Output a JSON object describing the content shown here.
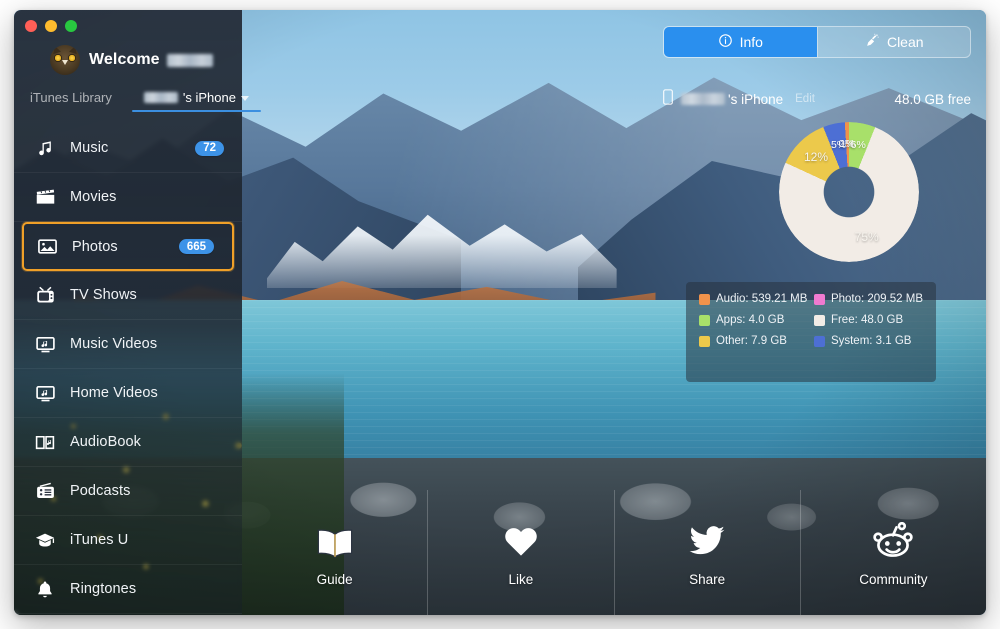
{
  "window": {
    "traffic_lights": [
      "close",
      "minimize",
      "zoom"
    ],
    "accent_blue": "#2a8fee",
    "highlight_orange": "#f0a028"
  },
  "sidebar": {
    "welcome_label": "Welcome",
    "welcome_name_redacted": true,
    "tabs": [
      {
        "label": "iTunes Library",
        "active": false
      },
      {
        "label": "'s iPhone",
        "active": true,
        "name_redacted": true
      }
    ],
    "items": [
      {
        "label": "Music",
        "icon": "music-note-icon",
        "badge": "72",
        "highlighted": false
      },
      {
        "label": "Movies",
        "icon": "clapperboard-icon",
        "badge": "",
        "highlighted": false
      },
      {
        "label": "Photos",
        "icon": "photo-icon",
        "badge": "665",
        "highlighted": true
      },
      {
        "label": "TV Shows",
        "icon": "television-icon",
        "badge": "",
        "highlighted": false
      },
      {
        "label": "Music Videos",
        "icon": "music-video-icon",
        "badge": "",
        "highlighted": false
      },
      {
        "label": "Home Videos",
        "icon": "home-video-icon",
        "badge": "",
        "highlighted": false
      },
      {
        "label": "AudioBook",
        "icon": "audiobook-icon",
        "badge": "",
        "highlighted": false
      },
      {
        "label": "Podcasts",
        "icon": "podcast-icon",
        "badge": "",
        "highlighted": false
      },
      {
        "label": "iTunes U",
        "icon": "graduation-cap-icon",
        "badge": "",
        "highlighted": false
      },
      {
        "label": "Ringtones",
        "icon": "bell-icon",
        "badge": "",
        "highlighted": false
      }
    ]
  },
  "toolbar": {
    "info_label": "Info",
    "info_icon": "info-circle-icon",
    "info_active": true,
    "clean_label": "Clean",
    "clean_icon": "broom-icon",
    "clean_active": false
  },
  "device": {
    "icon": "iphone-icon",
    "name_suffix": "'s iPhone",
    "name_redacted": true,
    "edit_label": "Edit",
    "free_space": "48.0 GB free"
  },
  "chart_data": {
    "type": "pie",
    "title": "",
    "subtype": "donut",
    "legend_position": "below",
    "categories": [
      "Free",
      "Other",
      "System",
      "Photo",
      "Audio",
      "Apps"
    ],
    "values": [
      75,
      12,
      5,
      0,
      1,
      6
    ],
    "value_labels": [
      "75%",
      "12%",
      "5%",
      "0%",
      "1%",
      "6%"
    ],
    "colors": [
      "#f2ece6",
      "#ecc94b",
      "#4d6fd4",
      "#f07ad0",
      "#f0924b",
      "#a8e06a"
    ],
    "sizes": [
      "48.0 GB",
      "7.9 GB",
      "3.1 GB",
      "209.52 MB",
      "539.21 MB",
      "4.0 GB"
    ],
    "legend": [
      {
        "label": "Audio",
        "value": "539.21 MB",
        "color": "#f0924b"
      },
      {
        "label": "Photo",
        "value": "209.52 MB",
        "color": "#f07ad0"
      },
      {
        "label": "Apps",
        "value": "4.0 GB",
        "color": "#a8e06a"
      },
      {
        "label": "Free",
        "value": "48.0 GB",
        "color": "#f2ece6"
      },
      {
        "label": "Other",
        "value": "7.9 GB",
        "color": "#ecc94b"
      },
      {
        "label": "System",
        "value": "3.1 GB",
        "color": "#4d6fd4"
      }
    ]
  },
  "social_bar": [
    {
      "label": "Guide",
      "icon": "open-book-icon"
    },
    {
      "label": "Like",
      "icon": "heart-icon"
    },
    {
      "label": "Share",
      "icon": "twitter-bird-icon"
    },
    {
      "label": "Community",
      "icon": "reddit-alien-icon"
    }
  ]
}
